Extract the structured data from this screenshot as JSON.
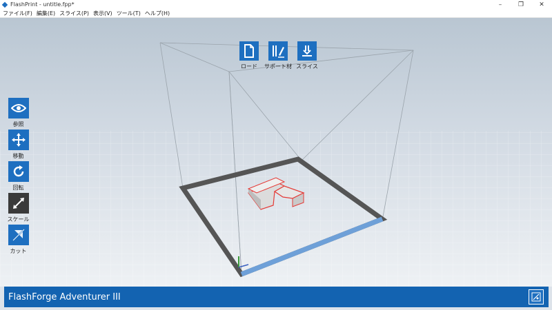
{
  "window": {
    "title": "FlashPrint - untitle.fpp*",
    "minimize_glyph": "–",
    "restore_glyph": "❐",
    "close_glyph": "✕"
  },
  "menu": {
    "items": [
      {
        "label": "ファイル(F)"
      },
      {
        "label": "編集(E)"
      },
      {
        "label": "スライス(P)"
      },
      {
        "label": "表示(V)"
      },
      {
        "label": "ツール(T)"
      },
      {
        "label": "ヘルプ(H)"
      }
    ]
  },
  "top_toolbar": {
    "load_label": "ロード",
    "support_label": "サポート材",
    "slice_label": "スライス"
  },
  "left_toolbar": {
    "view_label": "参照",
    "move_label": "移動",
    "rotate_label": "回転",
    "scale_label": "スケール",
    "cut_label": "カット"
  },
  "statusbar": {
    "printer_name": "FlashForge Adventurer III"
  },
  "colors": {
    "accent": "#1e6fc0",
    "statusbar": "#1363b1",
    "model_outline": "#e53935",
    "bed_border": "#5a5a5a",
    "bed_front_highlight": "#6ea0d8"
  },
  "icons": [
    "file-icon",
    "support-icon",
    "slice-icon",
    "eye-icon",
    "move-icon",
    "rotate-icon",
    "scale-icon",
    "cut-icon",
    "printer-settings-icon"
  ]
}
